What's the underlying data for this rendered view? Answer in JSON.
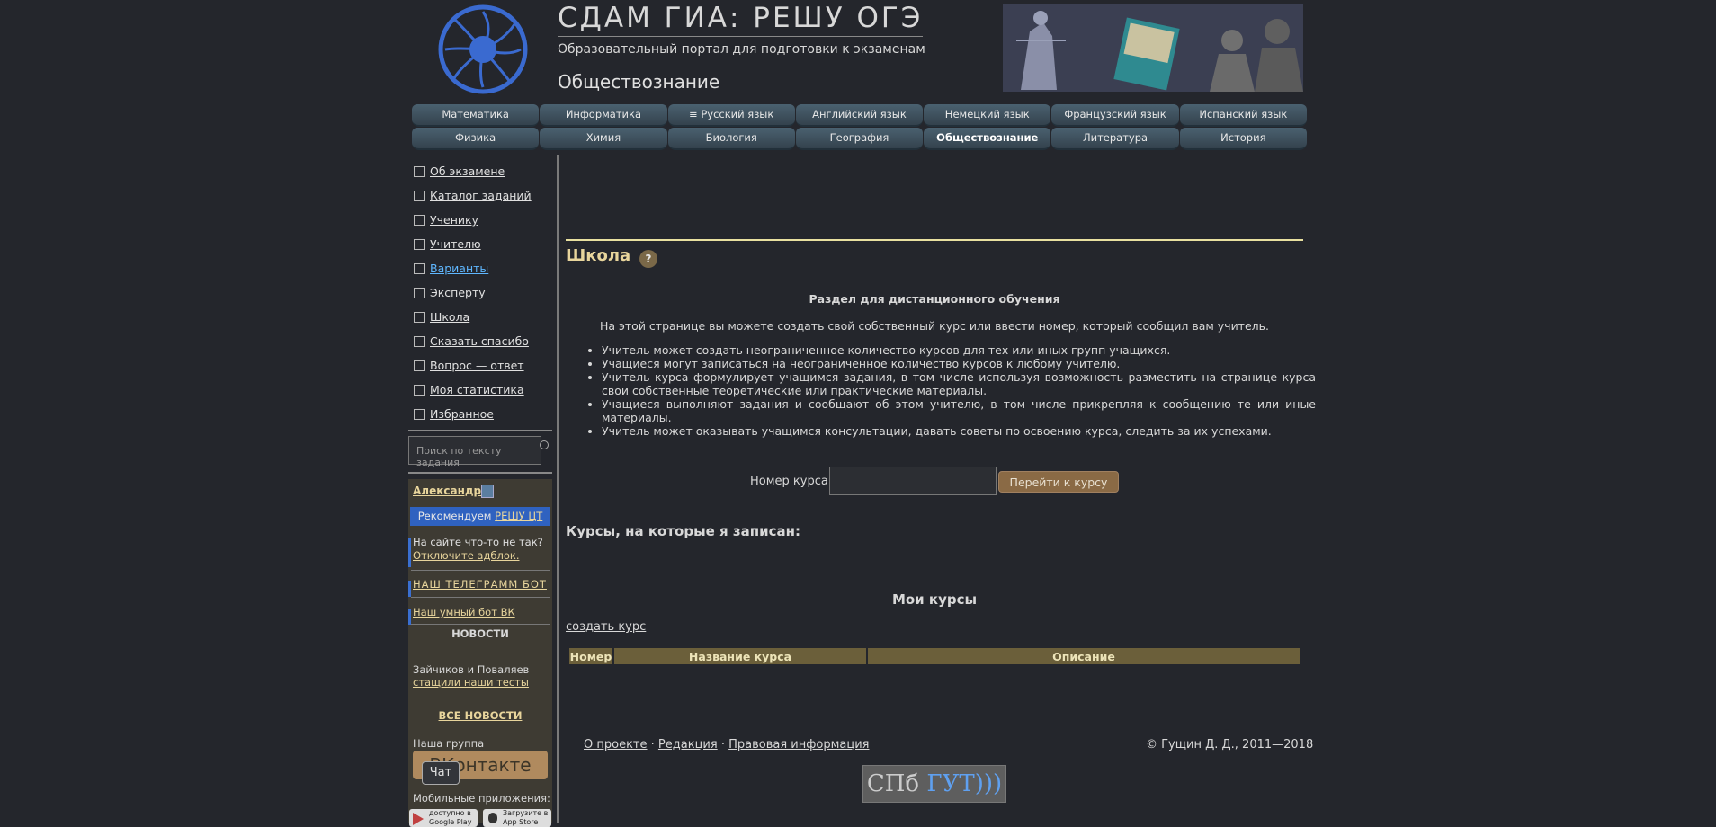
{
  "header": {
    "title": "СДАМ ГИА: РЕШУ ОГЭ",
    "subtitle": "Образовательный портал для подготовки к экзаменам",
    "subject": "Обществознание"
  },
  "subject_tabs": {
    "row1": [
      "Математика",
      "Информатика",
      "≡ Русский язык",
      "Английский язык",
      "Немецкий язык",
      "Французский язык",
      "Испанский язык"
    ],
    "row2": [
      "Физика",
      "Химия",
      "Биология",
      "География",
      "Обществознание",
      "Литература",
      "История"
    ],
    "active": "Обществознание"
  },
  "sidebar": {
    "items": [
      "Об экзамене",
      "Каталог заданий",
      "Ученику",
      "Учителю",
      "Варианты",
      "Эксперту",
      "Школа",
      "Сказать спасибо",
      "Вопрос — ответ",
      "Моя статистика",
      "Избранное"
    ],
    "search_placeholder": "Поиск по тексту задания",
    "user_name": "Александр",
    "recommend_prefix": "Рекомендуем",
    "recommend_link": "РЕШУ ЦТ",
    "adblock_text": "На сайте что-то не так?",
    "adblock_link": "Отключите адблок.",
    "telegram": "НАШ ТЕЛЕГРАММ БОТ",
    "vk_bot": "Наш умный бот ВК",
    "news_heading": "НОВОСТИ",
    "news_text": "Зайчиков и Поваляев",
    "news_link": "стащили наши тесты",
    "all_news": "ВСЕ НОВОСТИ",
    "group_label": "Наша группа",
    "vk_button": "ВКонтакте",
    "chat_button": "Чат",
    "apps_label": "Мобильные приложения:",
    "google_play_small": "доступно в",
    "google_play": "Google Play",
    "app_store_small": "Загрузите в",
    "app_store": "App Store"
  },
  "main": {
    "heading": "Школа",
    "help": "?",
    "section_title": "Раздел для дистанционного обучения",
    "intro": "На этой странице вы можете создать свой собственный курс или ввести номер, который сообщил вам учитель.",
    "bullets": [
      "Учитель может создать неограниченное количество курсов для тех или иных групп учащихся.",
      "Учащиеся могут записаться на неограниченное количество курсов к любому учителю.",
      "Учитель курса формулирует учащимся задания, в том числе используя возможность разместить на странице курса свои собственные теоретические или практические материалы.",
      "Учащиеся выполняют задания и сообщают об этом учителю, в том числе прикрепляя к сообщению те или иные материалы.",
      "Учитель может оказывать учащимся консультации, давать советы по освоению курса, следить за их успехами."
    ],
    "course_label": "Номер курса:",
    "course_input_value": "",
    "course_button": "Перейти к курсу",
    "enrolled_heading": "Курсы, на которые я записан:",
    "my_courses_heading": "Мои курсы",
    "create_course": "создать курс",
    "table_headers": [
      "Номер",
      "Название курса",
      "Описание"
    ]
  },
  "footer": {
    "links": [
      "О проекте",
      "Редакция",
      "Правовая информация"
    ],
    "separator": "·",
    "copyright": "© Гущин Д. Д., 2011—2018",
    "logo_left": "СПб",
    "logo_right": "ГУТ)))"
  },
  "colors": {
    "background": "#24262c",
    "accent_gold": "#e8d59c",
    "table_header": "#6b5f3a",
    "tab": "#3e5260",
    "recommend_bar": "#2f62c0"
  }
}
